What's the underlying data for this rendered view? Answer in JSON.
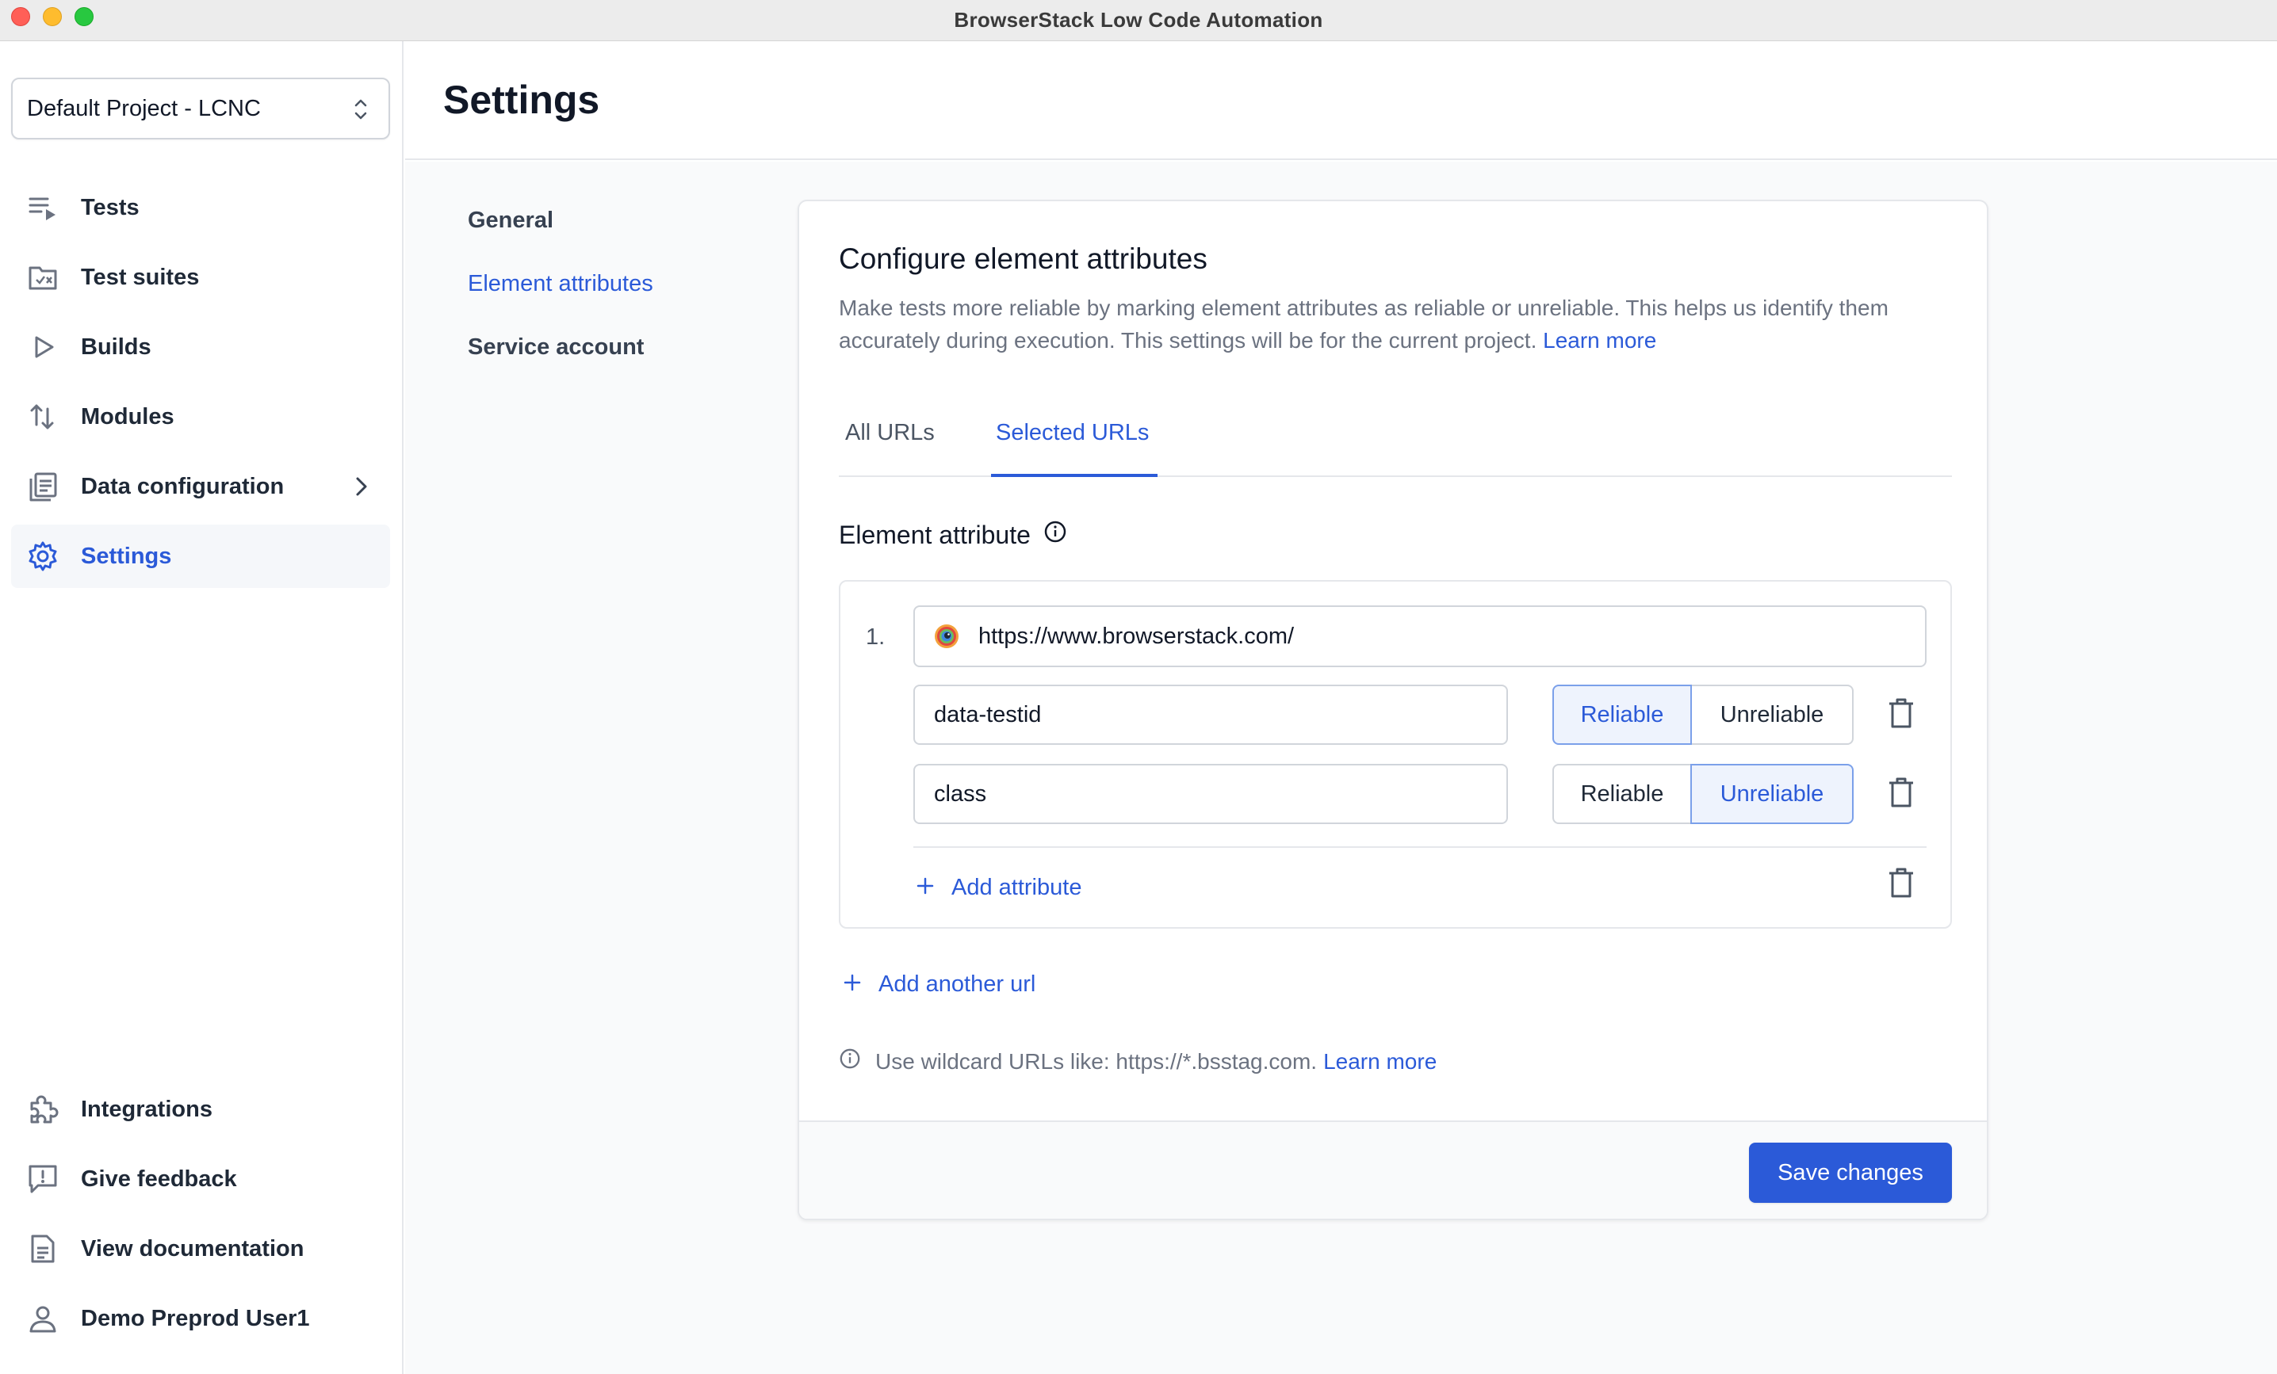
{
  "window": {
    "title": "BrowserStack Low Code Automation"
  },
  "sidebar": {
    "project": {
      "value": "Default Project - LCNC",
      "icon": "chevron-up-down-icon"
    },
    "items": [
      {
        "label": "Tests",
        "icon": "list-play-icon"
      },
      {
        "label": "Test suites",
        "icon": "folder-check-icon"
      },
      {
        "label": "Builds",
        "icon": "play-icon"
      },
      {
        "label": "Modules",
        "icon": "arrows-updown-icon"
      },
      {
        "label": "Data configuration",
        "icon": "data-stack-icon",
        "expandable": true
      },
      {
        "label": "Settings",
        "icon": "gear-icon",
        "active": true
      }
    ],
    "bottom_items": [
      {
        "label": "Integrations",
        "icon": "puzzle-icon"
      },
      {
        "label": "Give feedback",
        "icon": "feedback-icon"
      },
      {
        "label": "View documentation",
        "icon": "document-icon"
      },
      {
        "label": "Demo Preprod User1",
        "icon": "user-icon"
      }
    ]
  },
  "header": {
    "title": "Settings"
  },
  "settings_nav": {
    "items": [
      {
        "label": "General"
      },
      {
        "label": "Element attributes",
        "active": true
      },
      {
        "label": "Service account"
      }
    ]
  },
  "card": {
    "title": "Configure element attributes",
    "description": "Make tests more reliable by marking element attributes as reliable or unreliable. This helps us identify them accurately during execution. This settings will be for the current project.",
    "learn_more": "Learn more",
    "tabs": [
      {
        "label": "All URLs"
      },
      {
        "label": "Selected URLs",
        "active": true
      }
    ],
    "section_title": "Element attribute",
    "url_entries": [
      {
        "index": "1.",
        "url": "https://www.browserstack.com/",
        "attributes": [
          {
            "name": "data-testid",
            "status": "Reliable"
          },
          {
            "name": "class",
            "status": "Unreliable"
          }
        ],
        "add_attribute_label": "Add attribute"
      }
    ],
    "toggle_labels": {
      "reliable": "Reliable",
      "unreliable": "Unreliable"
    },
    "add_url_label": "Add another url",
    "hint": "Use wildcard URLs like: https://*.bsstag.com.",
    "hint_link": "Learn more",
    "save_label": "Save changes"
  },
  "colors": {
    "accent": "#2b5ad8",
    "selected_bg": "#eef3fd"
  }
}
